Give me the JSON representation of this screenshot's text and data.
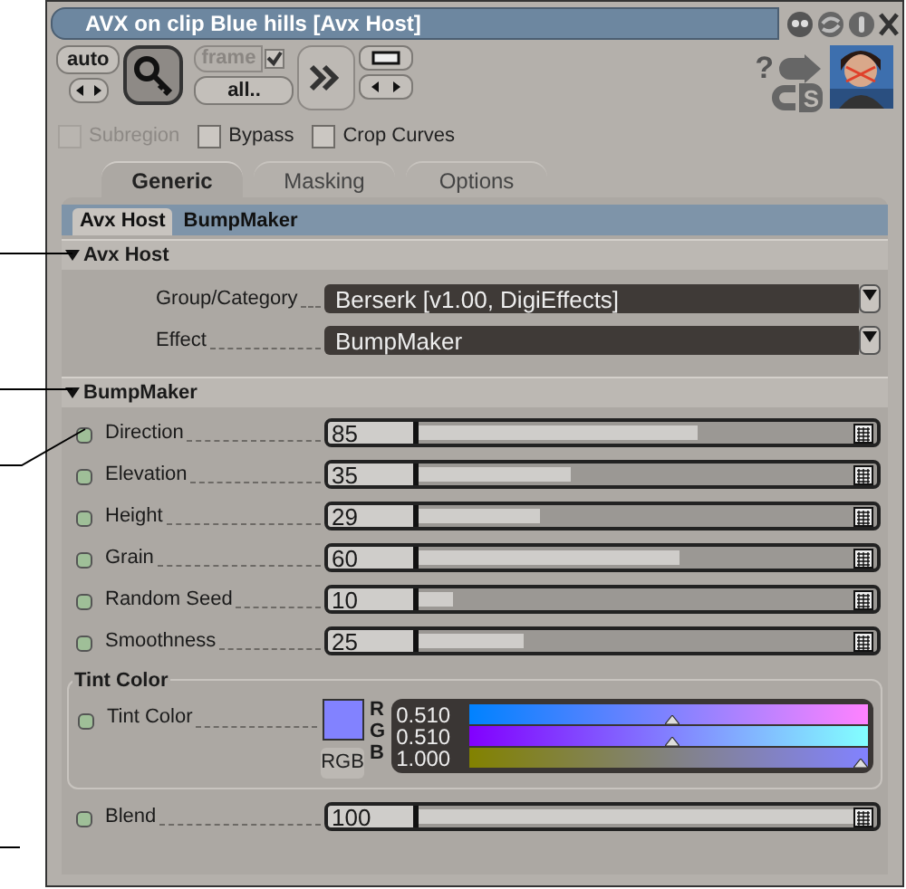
{
  "window": {
    "title": "AVX on clip Blue hills [Avx Host]"
  },
  "toolbar": {
    "auto_label": "auto",
    "key_pressed": true,
    "frame_label": "frame",
    "frame_checked": true,
    "all_label": "all..",
    "help_label": "?",
    "cs_label": "S"
  },
  "options": [
    {
      "label": "Subregion",
      "checked": false,
      "disabled": true
    },
    {
      "label": "Bypass",
      "checked": false,
      "disabled": false
    },
    {
      "label": "Crop Curves",
      "checked": false,
      "disabled": false
    }
  ],
  "tabs": [
    {
      "label": "Generic",
      "selected": true
    },
    {
      "label": "Masking",
      "selected": false
    },
    {
      "label": "Options",
      "selected": false
    }
  ],
  "subtabs": [
    {
      "label": "Avx Host",
      "selected": true
    },
    {
      "label": "BumpMaker",
      "selected": false
    }
  ],
  "sections": [
    {
      "title": "Avx Host",
      "expanded": true,
      "rows": [
        {
          "kind": "dropdown",
          "label": "Group/Category",
          "value": "Berserk [v1.00, DigiEffects]"
        },
        {
          "kind": "dropdown",
          "label": "Effect",
          "value": "BumpMaker"
        }
      ]
    },
    {
      "title": "BumpMaker",
      "expanded": true,
      "rows": [
        {
          "kind": "slider",
          "label": "Direction",
          "value": "85",
          "level": 0.64
        },
        {
          "kind": "slider",
          "label": "Elevation",
          "value": "35",
          "level": 0.35
        },
        {
          "kind": "slider",
          "label": "Height",
          "value": "29",
          "level": 0.28
        },
        {
          "kind": "slider",
          "label": "Grain",
          "value": "60",
          "level": 0.6
        },
        {
          "kind": "slider",
          "label": "Random Seed",
          "value": "10",
          "level": 0.08
        },
        {
          "kind": "slider",
          "label": "Smoothness",
          "value": "25",
          "level": 0.24
        },
        {
          "kind": "color",
          "title": "Tint Color",
          "label": "Tint Color",
          "mode": "RGB",
          "channels": [
            {
              "name": "R",
              "value": "0.510",
              "level": 0.51
            },
            {
              "name": "G",
              "value": "0.510",
              "level": 0.51
            },
            {
              "name": "B",
              "value": "1.000",
              "level": 1
            }
          ]
        },
        {
          "kind": "slider",
          "label": "Blend",
          "value": "100",
          "level": 1
        }
      ]
    }
  ]
}
